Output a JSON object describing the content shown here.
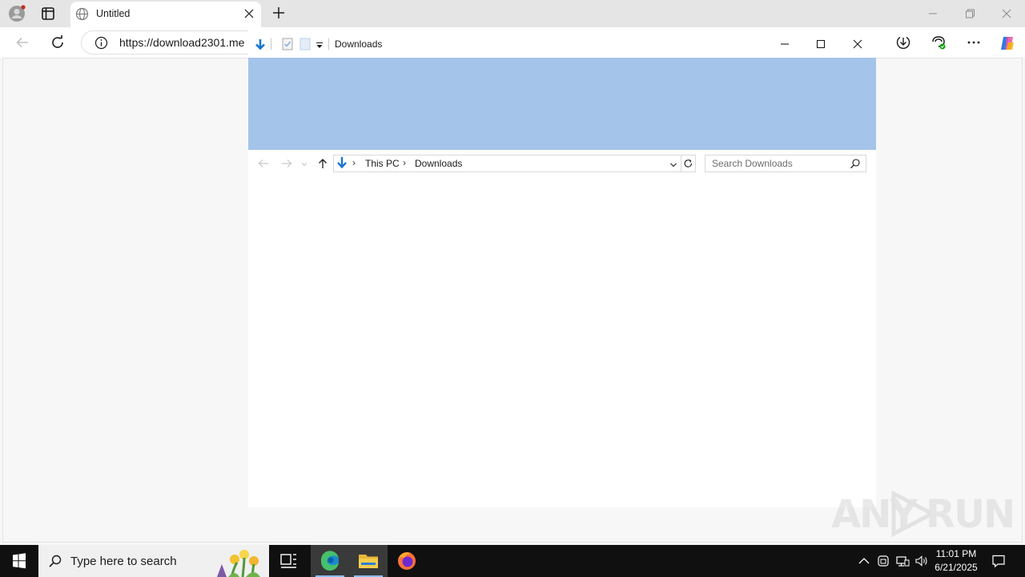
{
  "browser": {
    "tab": {
      "title": "Untitled"
    },
    "address_bar": {
      "url": "https://download2301.me"
    }
  },
  "explorer": {
    "window_title": "Downloads",
    "breadcrumb": [
      "This PC",
      "Downloads"
    ],
    "search": {
      "placeholder": "Search Downloads"
    },
    "ribbon_color": "#a4c4e9"
  },
  "watermark": {
    "text_left": "ANY",
    "text_right": "RUN"
  },
  "taskbar": {
    "search_placeholder": "Type here to search",
    "time": "11:01 PM",
    "date": "6/21/2025"
  },
  "icons": [
    "profile-icon",
    "tab-actions-icon",
    "globe-icon",
    "close-icon",
    "plus-icon",
    "back-arrow-icon",
    "refresh-icon",
    "info-icon",
    "downloads-icon",
    "extensions-icon",
    "more-icon",
    "copilot-icon",
    "windows-logo-icon",
    "task-view-icon",
    "edge-icon",
    "file-explorer-icon",
    "firefox-icon",
    "search-icon"
  ]
}
